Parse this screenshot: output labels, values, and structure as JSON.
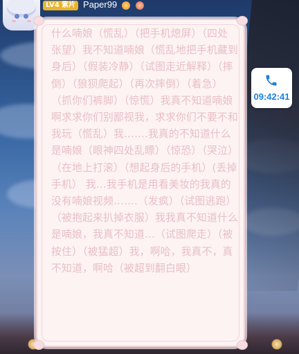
{
  "header": {
    "level_badge": "LV4 紫片",
    "username": "Paper99"
  },
  "message": {
    "text": "什么喃娘（慌乱）（把手机熄屏）（四处张望）我不知道喃娘（慌乱地把手机藏到身后）（假装冷静）（试图走近解释）（摔倒）（狼狈爬起）（再次摔倒）（着急）（抓你们裤脚）（惊慌）我真不知道喃娘啊求求你们别鄙视我，求求你们不要不和我玩（慌乱）我…….我真的不知道什么是喃娘（眼神四处乱瞟）（惊恐）（哭泣）（在地上打滚）（想起身后的手机）(丢掉手机） 我…我手机是用看美妆的我真的没有喃娘视频…….（发疯）（试图逃跑）（被抱起来扒掉衣服）我我真不知道什么是喃娘，我真不知道…（试图爬走）（被按住）（被猛超）我，啊哈，我真不，真不知道，啊哈（被超到翻白眼）"
  },
  "call_widget": {
    "time": "09:42:41",
    "icon": "phone-icon",
    "accent_color": "#1f7fe0"
  },
  "colors": {
    "bubble_bg": "#fdf3f3",
    "bubble_border": "#f1d2d6",
    "text": "#e7bfc4",
    "badge": "#e9b52c"
  }
}
